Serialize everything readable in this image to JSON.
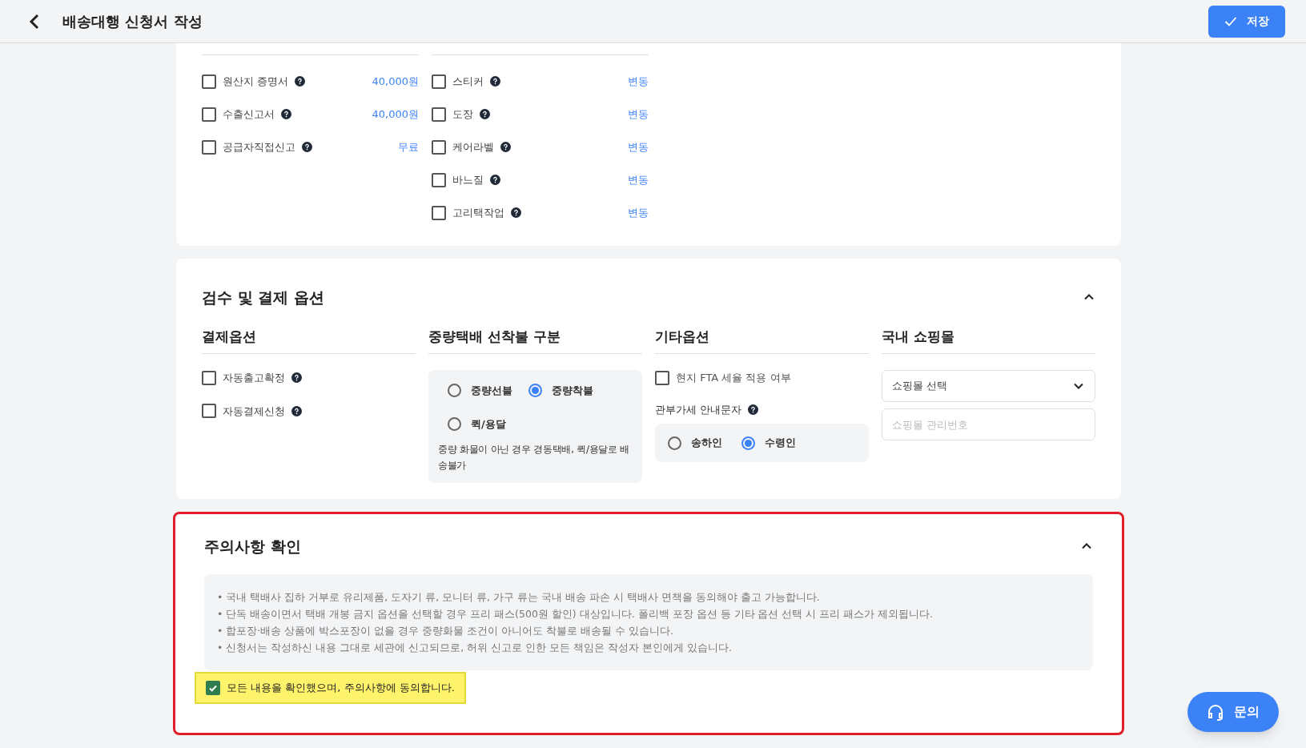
{
  "header": {
    "title": "배송대행 신청서 작성",
    "save_button": "저장"
  },
  "extra_services": {
    "columns": [
      {
        "items": [
          {
            "label": "원산지 증명서",
            "price": "40,000원",
            "checked": false
          },
          {
            "label": "수출신고서",
            "price": "40,000원",
            "checked": false
          },
          {
            "label": "공급자직접신고",
            "price": "무료",
            "checked": false
          }
        ]
      },
      {
        "items": [
          {
            "label": "스티커",
            "price": "변동",
            "checked": false
          },
          {
            "label": "도장",
            "price": "변동",
            "checked": false
          },
          {
            "label": "케어라벨",
            "price": "변동",
            "checked": false
          },
          {
            "label": "바느질",
            "price": "변동",
            "checked": false
          },
          {
            "label": "고리택작업",
            "price": "변동",
            "checked": false
          }
        ]
      }
    ]
  },
  "inspection": {
    "title": "검수 및 결제 옵션",
    "expanded": true,
    "payment": {
      "heading": "결제옵션",
      "items": [
        {
          "label": "자동출고확정",
          "checked": false
        },
        {
          "label": "자동결제신청",
          "checked": false
        }
      ]
    },
    "heavy": {
      "heading": "중량택배 선착불 구분",
      "options": [
        {
          "label": "중량선불",
          "selected": false
        },
        {
          "label": "중량착불",
          "selected": true
        },
        {
          "label": "퀵/용달",
          "selected": false
        }
      ],
      "note": "중량 화물이 아닌 경우 경동택배, 퀵/용달로 배송불가"
    },
    "other": {
      "heading": "기타옵션",
      "fta": {
        "label": "현지 FTA 세율 적용 여부",
        "checked": false
      },
      "sms_label": "관부가세 안내문자",
      "options": [
        {
          "label": "송하인",
          "selected": false
        },
        {
          "label": "수령인",
          "selected": true
        }
      ]
    },
    "mall": {
      "heading": "국내 쇼핑몰",
      "select": "쇼핑몰 선택",
      "placeholder": "쇼핑몰 관리번호"
    }
  },
  "notice": {
    "title": "주의사항 확인",
    "expanded": true,
    "highlighted": true,
    "lines": [
      "• 국내 택배사 집하 거부로 유리제품, 도자기 류, 모니터 류, 가구 류는 국내 배송 파손 시 택배사 면책을 동의해야 출고 가능합니다.",
      "• 단독 배송이면서 택배 개봉 금지 옵션을 선택할 경우 프리 패스(500원 할인) 대상입니다. 폴리백 포장 옵션 등 기타 옵션 선택 시 프리 패스가 제외됩니다.",
      "• 합포장·배송 상품에 박스포장이 없을 경우 중량화물 조건이 아니어도 착불로 배송될 수 있습니다.",
      "• 신청서는 작성하신 내용 그대로 세관에 신고되므로, 허위 신고로 인한 모든 책임은 작성자 본인에게 있습니다."
    ],
    "agree": {
      "label": "모든 내용을 확인했으며, 주의사항에 동의합니다.",
      "checked": true,
      "highlighted": true
    }
  },
  "help_button": "문의"
}
